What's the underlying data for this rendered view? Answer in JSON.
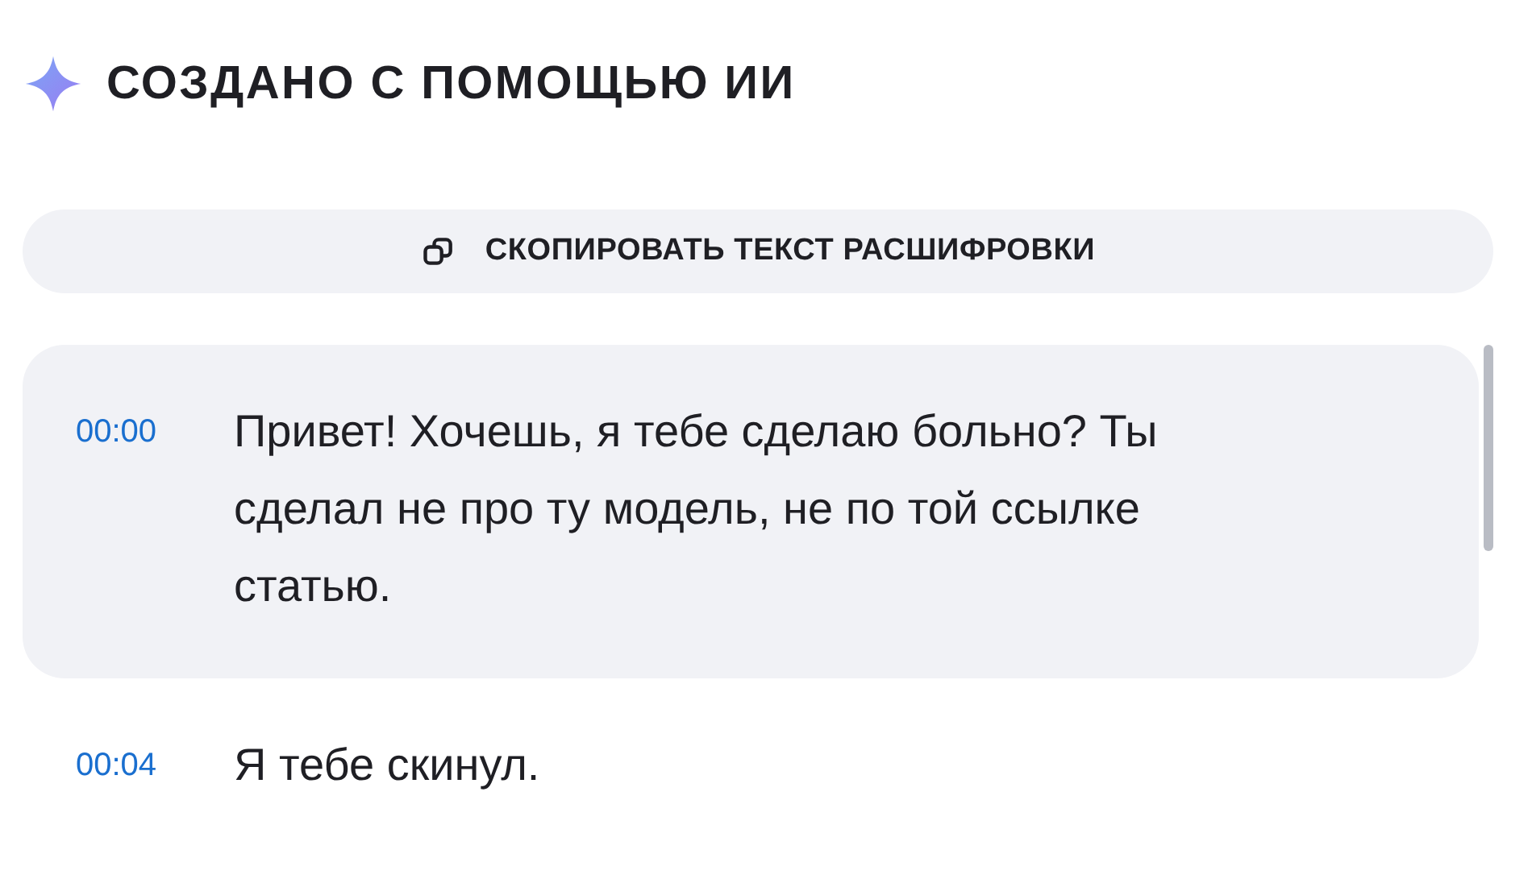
{
  "header": {
    "title": "СОЗДАНО С ПОМОЩЬЮ ИИ"
  },
  "copy_button": {
    "label": "СКОПИРОВАТЬ ТЕКСТ РАСШИФРОВКИ"
  },
  "segments": [
    {
      "time": "00:00",
      "text": "Привет! Хочешь, я тебе сделаю больно? Ты сделал не про ту модель, не по той ссылке статью.",
      "selected": true
    },
    {
      "time": "00:04",
      "text": "Я тебе скинул.",
      "selected": false
    }
  ]
}
